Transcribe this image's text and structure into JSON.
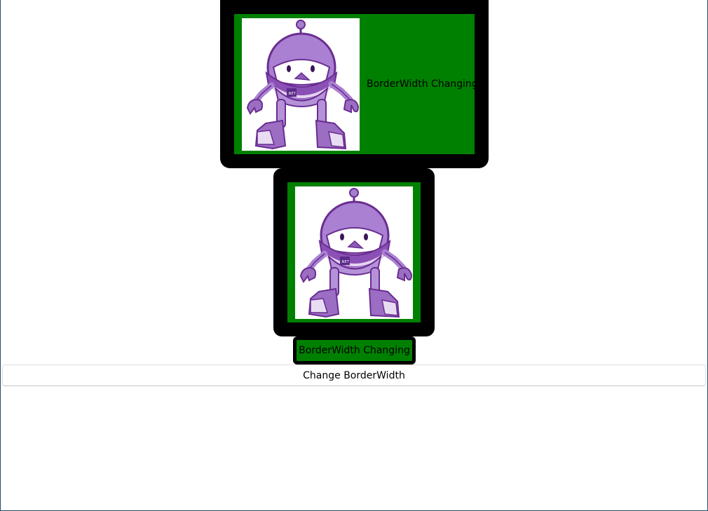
{
  "borders": [
    {
      "caption": "BorderWidth Changing",
      "image": "dotnet-bot-robot"
    },
    {
      "image": "dotnet-bot-robot"
    },
    {
      "caption": "BorderWidth Changing"
    }
  ],
  "button": {
    "label": "Change BorderWidth"
  },
  "colors": {
    "border_fill": "#008000",
    "border_stroke": "#000000",
    "robot_purple": "#9b6dc3",
    "robot_outline": "#6a2d91"
  }
}
